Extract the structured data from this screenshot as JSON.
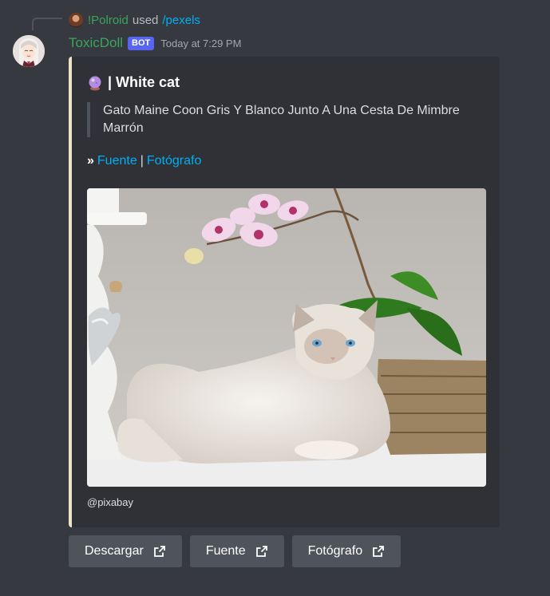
{
  "reply": {
    "user": "!Polroid",
    "used": "used",
    "command": "/pexels"
  },
  "message": {
    "username": "ToxicDoll",
    "bot_tag": "BOT",
    "timestamp": "Today at 7:29 PM"
  },
  "embed": {
    "accent_color": "#e9e4c6",
    "title": "| White cat",
    "title_icon": "crystal-ball-icon",
    "description": "Gato Maine Coon Gris Y Blanco Junto A Una Cesta De Mimbre Marrón",
    "links_prefix": "»",
    "link_source": "Fuente",
    "link_separator": "|",
    "link_photographer": "Fotógrafo",
    "image_alt": "white cat lying next to a wicker basket and orchid",
    "footer": "@pixabay"
  },
  "buttons": [
    {
      "label": "Descargar",
      "icon": "external-link-icon"
    },
    {
      "label": "Fuente",
      "icon": "external-link-icon"
    },
    {
      "label": "Fotógrafo",
      "icon": "external-link-icon"
    }
  ]
}
